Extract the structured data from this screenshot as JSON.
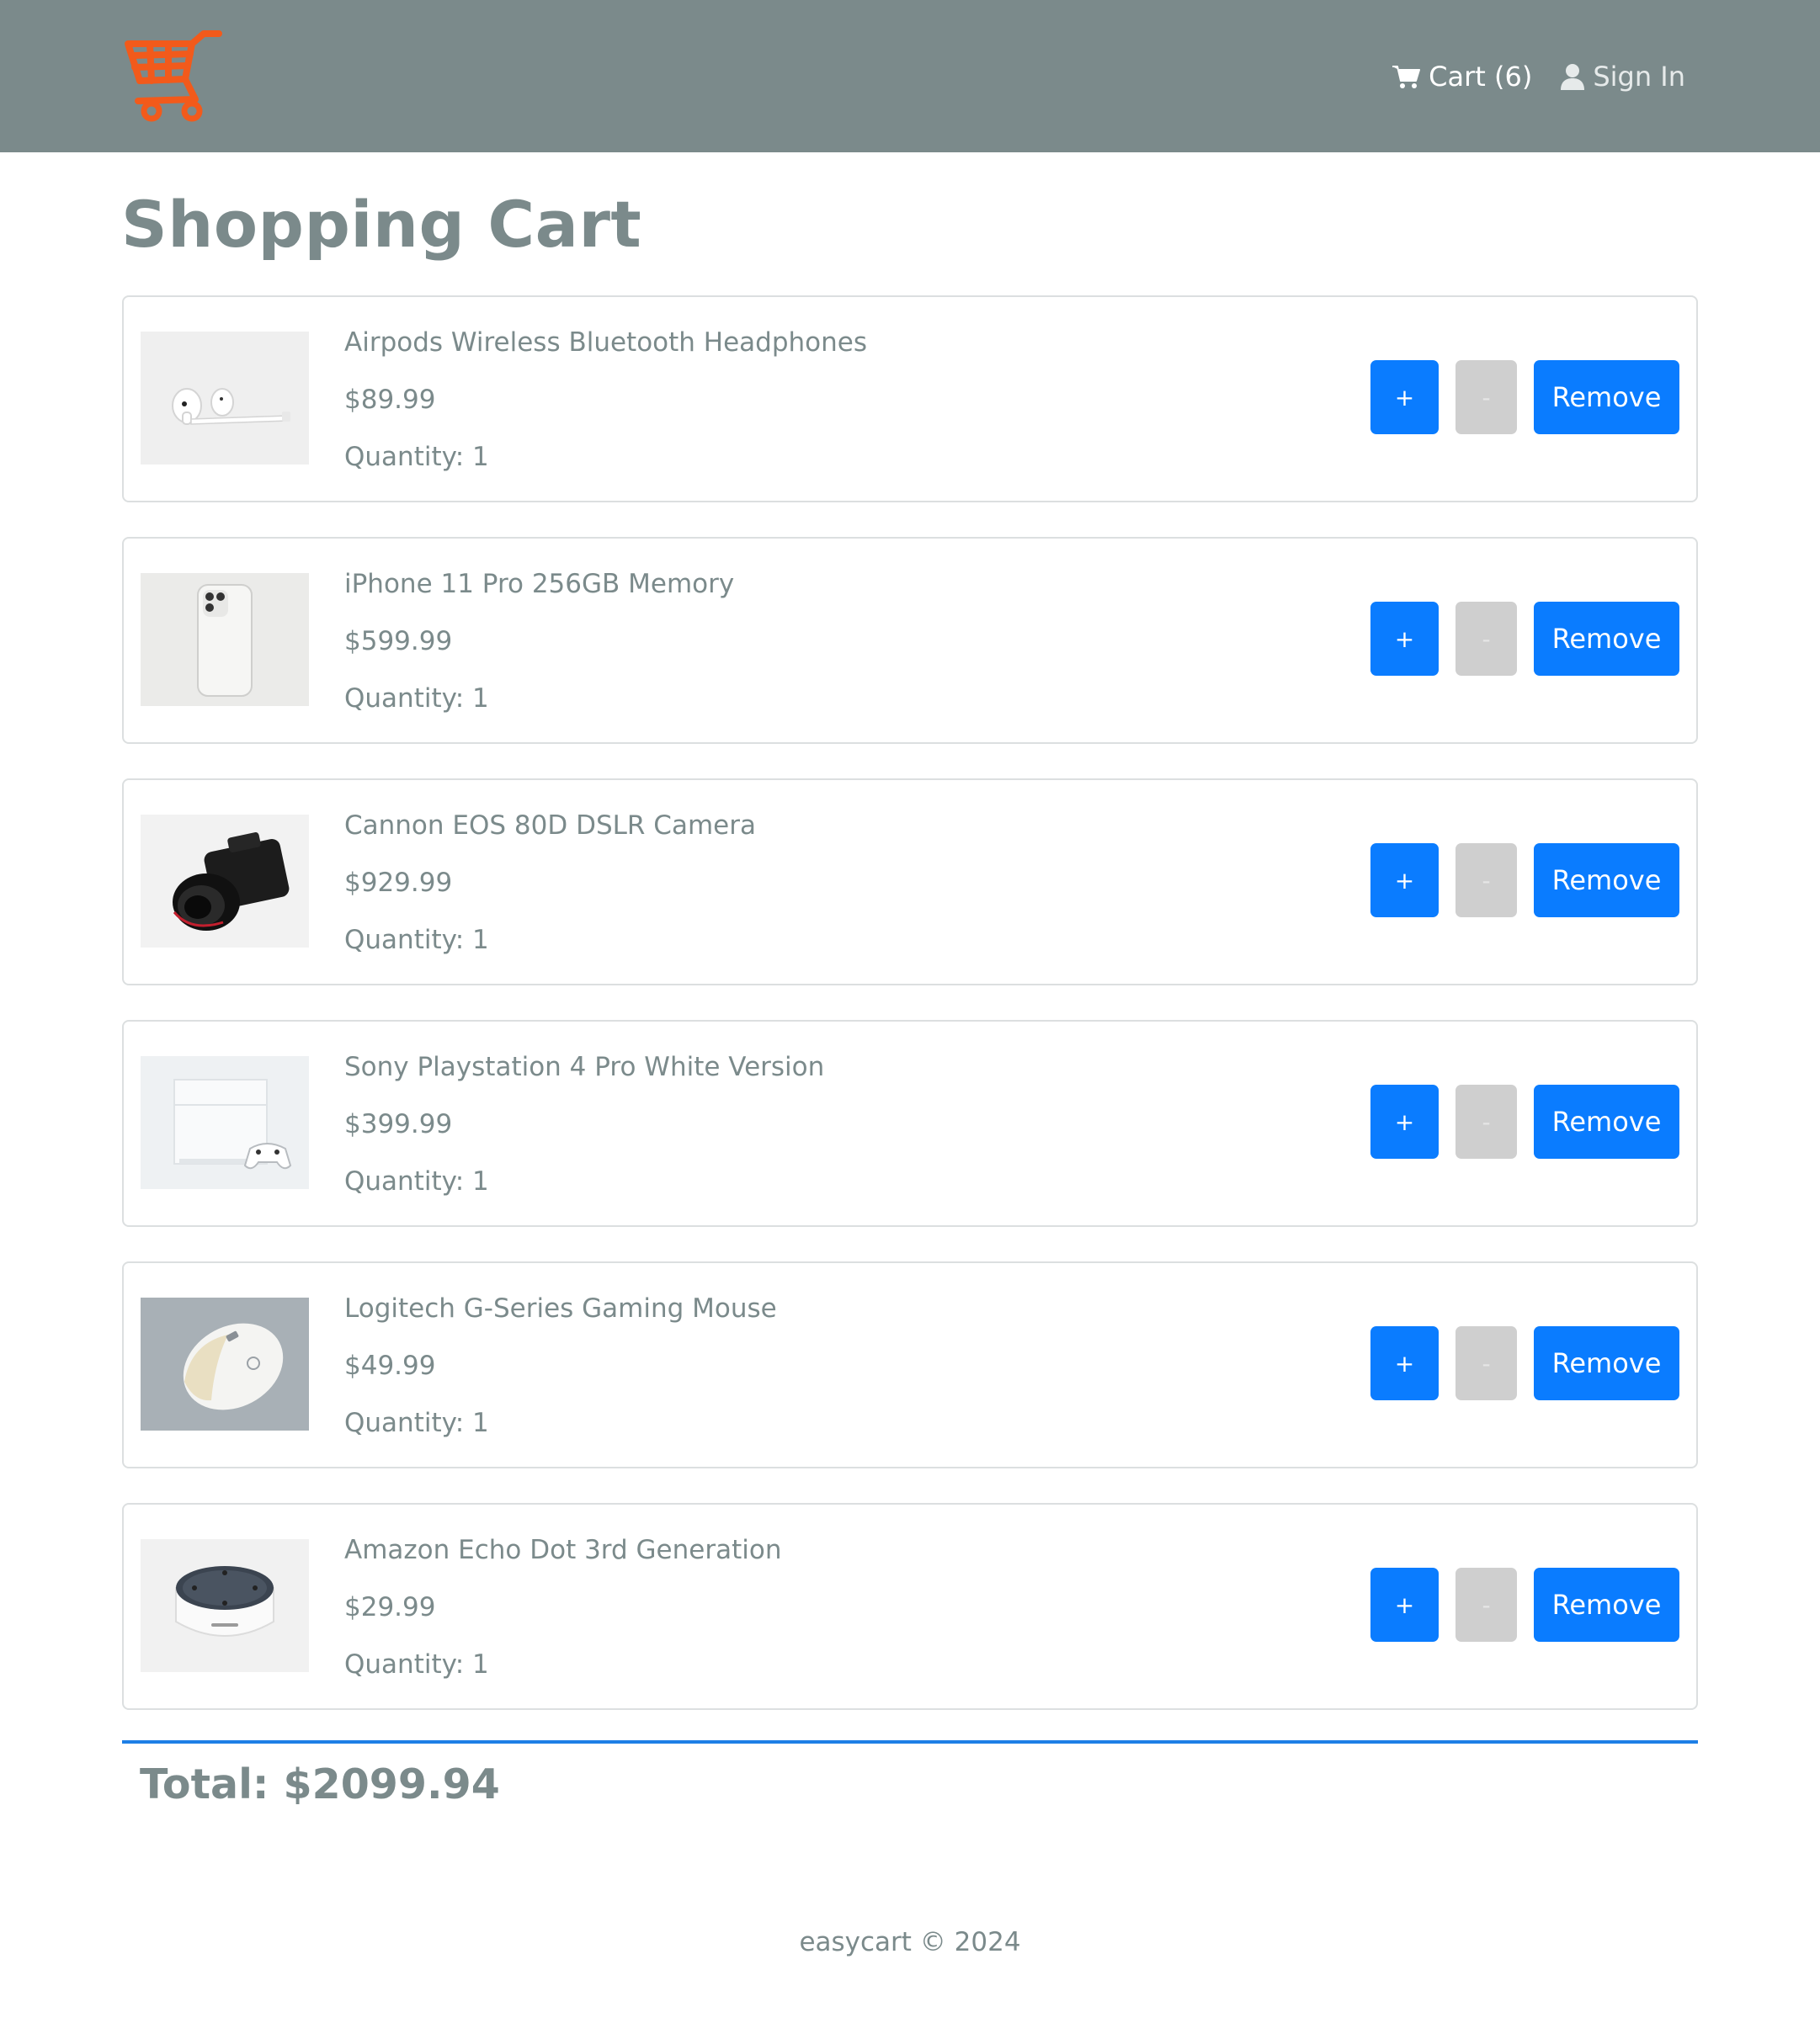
{
  "header": {
    "logo_icon": "shopping-cart-logo-icon",
    "brand_color": "#f25a1b",
    "nav": {
      "cart_label": "Cart (6)",
      "signin_label": "Sign In"
    }
  },
  "page": {
    "title": "Shopping Cart"
  },
  "cart": {
    "items": [
      {
        "name": "Airpods Wireless Bluetooth Headphones",
        "price": "$89.99",
        "quantity_label": "Quantity: 1",
        "image_icon": "airpods-image",
        "plus_label": "+",
        "minus_label": "-",
        "remove_label": "Remove"
      },
      {
        "name": "iPhone 11 Pro 256GB Memory",
        "price": "$599.99",
        "quantity_label": "Quantity: 1",
        "image_icon": "iphone-image",
        "plus_label": "+",
        "minus_label": "-",
        "remove_label": "Remove"
      },
      {
        "name": "Cannon EOS 80D DSLR Camera",
        "price": "$929.99",
        "quantity_label": "Quantity: 1",
        "image_icon": "camera-image",
        "plus_label": "+",
        "minus_label": "-",
        "remove_label": "Remove"
      },
      {
        "name": "Sony Playstation 4 Pro White Version",
        "price": "$399.99",
        "quantity_label": "Quantity: 1",
        "image_icon": "playstation-image",
        "plus_label": "+",
        "minus_label": "-",
        "remove_label": "Remove"
      },
      {
        "name": "Logitech G-Series Gaming Mouse",
        "price": "$49.99",
        "quantity_label": "Quantity: 1",
        "image_icon": "mouse-image",
        "plus_label": "+",
        "minus_label": "-",
        "remove_label": "Remove"
      },
      {
        "name": "Amazon Echo Dot 3rd Generation",
        "price": "$29.99",
        "quantity_label": "Quantity: 1",
        "image_icon": "echo-dot-image",
        "plus_label": "+",
        "minus_label": "-",
        "remove_label": "Remove"
      }
    ],
    "total_label": "Total: $2099.94"
  },
  "footer": {
    "text": "easycart © 2024"
  },
  "colors": {
    "navbar": "#7b8a8b",
    "primary_button": "#0a7cff",
    "disabled_button": "#cfcfcf",
    "divider": "#1e7fe6"
  }
}
